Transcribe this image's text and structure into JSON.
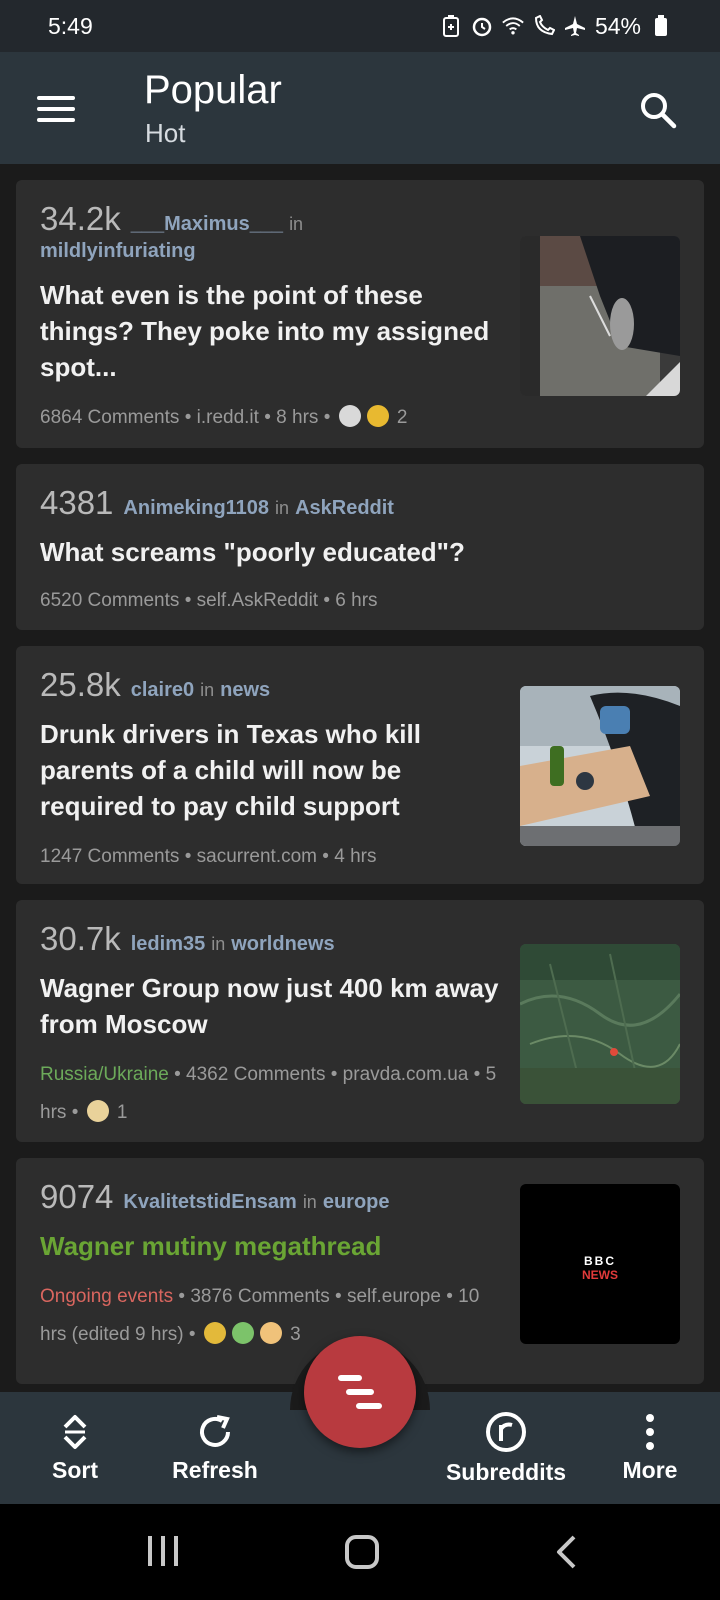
{
  "status_bar": {
    "time": "5:49",
    "battery": "54%"
  },
  "app_bar": {
    "title": "Popular",
    "subtitle": "Hot"
  },
  "posts": [
    {
      "score": "34.2k",
      "author": "___Maximus___",
      "in": "in",
      "subreddit": "mildlyinfuriating",
      "title": "What even is the point of these things? They poke into my assigned spot...",
      "comments": "6864 Comments",
      "domain": "i.redd.it",
      "age": "8 hrs",
      "awards_count": "2"
    },
    {
      "score": "4381",
      "author": "Animeking1108",
      "in": "in",
      "subreddit": "AskReddit",
      "title": "What screams \"poorly educated\"?",
      "comments": "6520 Comments",
      "domain": "self.AskReddit",
      "age": "6 hrs"
    },
    {
      "score": "25.8k",
      "author": "claire0",
      "in": "in",
      "subreddit": "news",
      "title": "Drunk drivers in Texas who kill parents of a child will now be required to pay child support",
      "comments": "1247 Comments",
      "domain": "sacurrent.com",
      "age": "4 hrs"
    },
    {
      "score": "30.7k",
      "author": "ledim35",
      "in": "in",
      "subreddit": "worldnews",
      "title": "Wagner Group now just 400 km away from Moscow",
      "flair": "Russia/Ukraine",
      "comments": "4362 Comments",
      "domain": "pravda.com.ua",
      "age": "5 hrs",
      "awards_count": "1"
    },
    {
      "score": "9074",
      "author": "KvalitetstidEnsam",
      "in": "in",
      "subreddit": "europe",
      "title": "Wagner mutiny megathread",
      "flair": "Ongoing events",
      "comments": "3876 Comments",
      "domain": "self.europe",
      "age": "10 hrs (edited 9 hrs)",
      "awards_count": "3",
      "thumb_text_top": "BBC",
      "thumb_text_bottom": "NEWS"
    }
  ],
  "bottom_bar": {
    "sort": "Sort",
    "refresh": "Refresh",
    "subreddits": "Subreddits",
    "more": "More"
  },
  "separator": "•",
  "colors": {
    "app_bar": "#2c363d",
    "card": "#2d2d2d",
    "accent_link": "#8fa4bd",
    "fab": "#b83a3f",
    "flair_green": "#6caa5a",
    "flair_red": "#d9665f",
    "title_green": "#6aa534"
  }
}
